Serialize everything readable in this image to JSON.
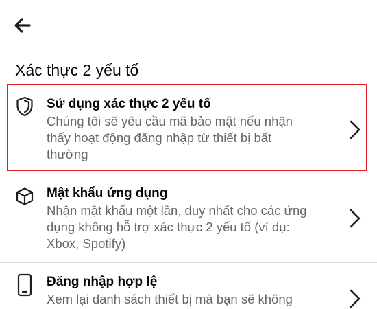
{
  "header": {
    "back_icon": "arrow-left-icon"
  },
  "section": {
    "title": "Xác thực 2 yếu tố"
  },
  "items": [
    {
      "icon": "shield-icon",
      "title": "Sử dụng xác thực 2 yếu tố",
      "desc_lines": [
        "Chúng tôi sẽ yêu cầu mã bảo mật nếu nhận",
        "thấy hoạt động đăng nhập từ thiết bị bất",
        "thường"
      ],
      "chevron": "chevron-right-icon"
    },
    {
      "icon": "cube-icon",
      "title": "Mật khẩu ứng dụng",
      "desc_lines": [
        "Nhận mật khẩu một lần, duy nhất cho các ứng",
        "dụng không hỗ trợ xác thực 2 yếu tố (ví dụ:",
        "Xbox, Spotify)"
      ],
      "chevron": "chevron-right-icon"
    },
    {
      "icon": "phone-icon",
      "title": "Đăng nhập hợp lệ",
      "desc_lines": [
        "Xem lại danh sách thiết bị mà bạn sẽ không"
      ],
      "chevron": "chevron-right-icon"
    }
  ],
  "colors": {
    "highlight": "#e41e26",
    "secondary_text": "#65676b",
    "divider": "#dadde1"
  }
}
